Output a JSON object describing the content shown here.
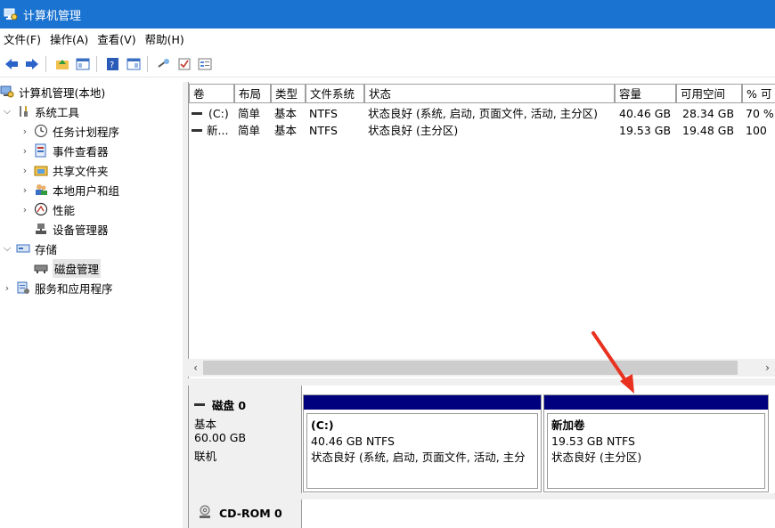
{
  "window": {
    "title": "计算机管理"
  },
  "menu": [
    "文件(F)",
    "操作(A)",
    "查看(V)",
    "帮助(H)"
  ],
  "tree": {
    "root": "计算机管理(本地)",
    "system_tools": "系统工具",
    "task_scheduler": "任务计划程序",
    "event_viewer": "事件查看器",
    "shared_folders": "共享文件夹",
    "local_users": "本地用户和组",
    "performance": "性能",
    "device_manager": "设备管理器",
    "storage": "存储",
    "disk_management": "磁盘管理",
    "services_apps": "服务和应用程序"
  },
  "volumes": {
    "columns": [
      "卷",
      "布局",
      "类型",
      "文件系统",
      "状态",
      "容量",
      "可用空间",
      "% 可"
    ],
    "rows": [
      {
        "volume": "(C:)",
        "layout": "简单",
        "type": "基本",
        "fs": "NTFS",
        "status": "状态良好 (系统, 启动, 页面文件, 活动, 主分区)",
        "capacity": "40.46 GB",
        "free": "28.34 GB",
        "pct": "70 %"
      },
      {
        "volume": "新...",
        "layout": "简单",
        "type": "基本",
        "fs": "NTFS",
        "status": "状态良好 (主分区)",
        "capacity": "19.53 GB",
        "free": "19.48 GB",
        "pct": "100"
      }
    ]
  },
  "disk0": {
    "name": "磁盘 0",
    "kind": "基本",
    "size": "60.00 GB",
    "state": "联机",
    "partitions": [
      {
        "name": "(C:)",
        "size": "40.46 GB NTFS",
        "status": "状态良好 (系统, 启动, 页面文件, 活动, 主分"
      },
      {
        "name": "新加卷",
        "size": "19.53 GB NTFS",
        "status": "状态良好 (主分区)"
      }
    ]
  },
  "cdrom": {
    "name": "CD-ROM 0"
  },
  "colors": {
    "titlebar": "#1a73d0",
    "partition_bar": "#00007f",
    "annotation_arrow": "#e8311f"
  }
}
